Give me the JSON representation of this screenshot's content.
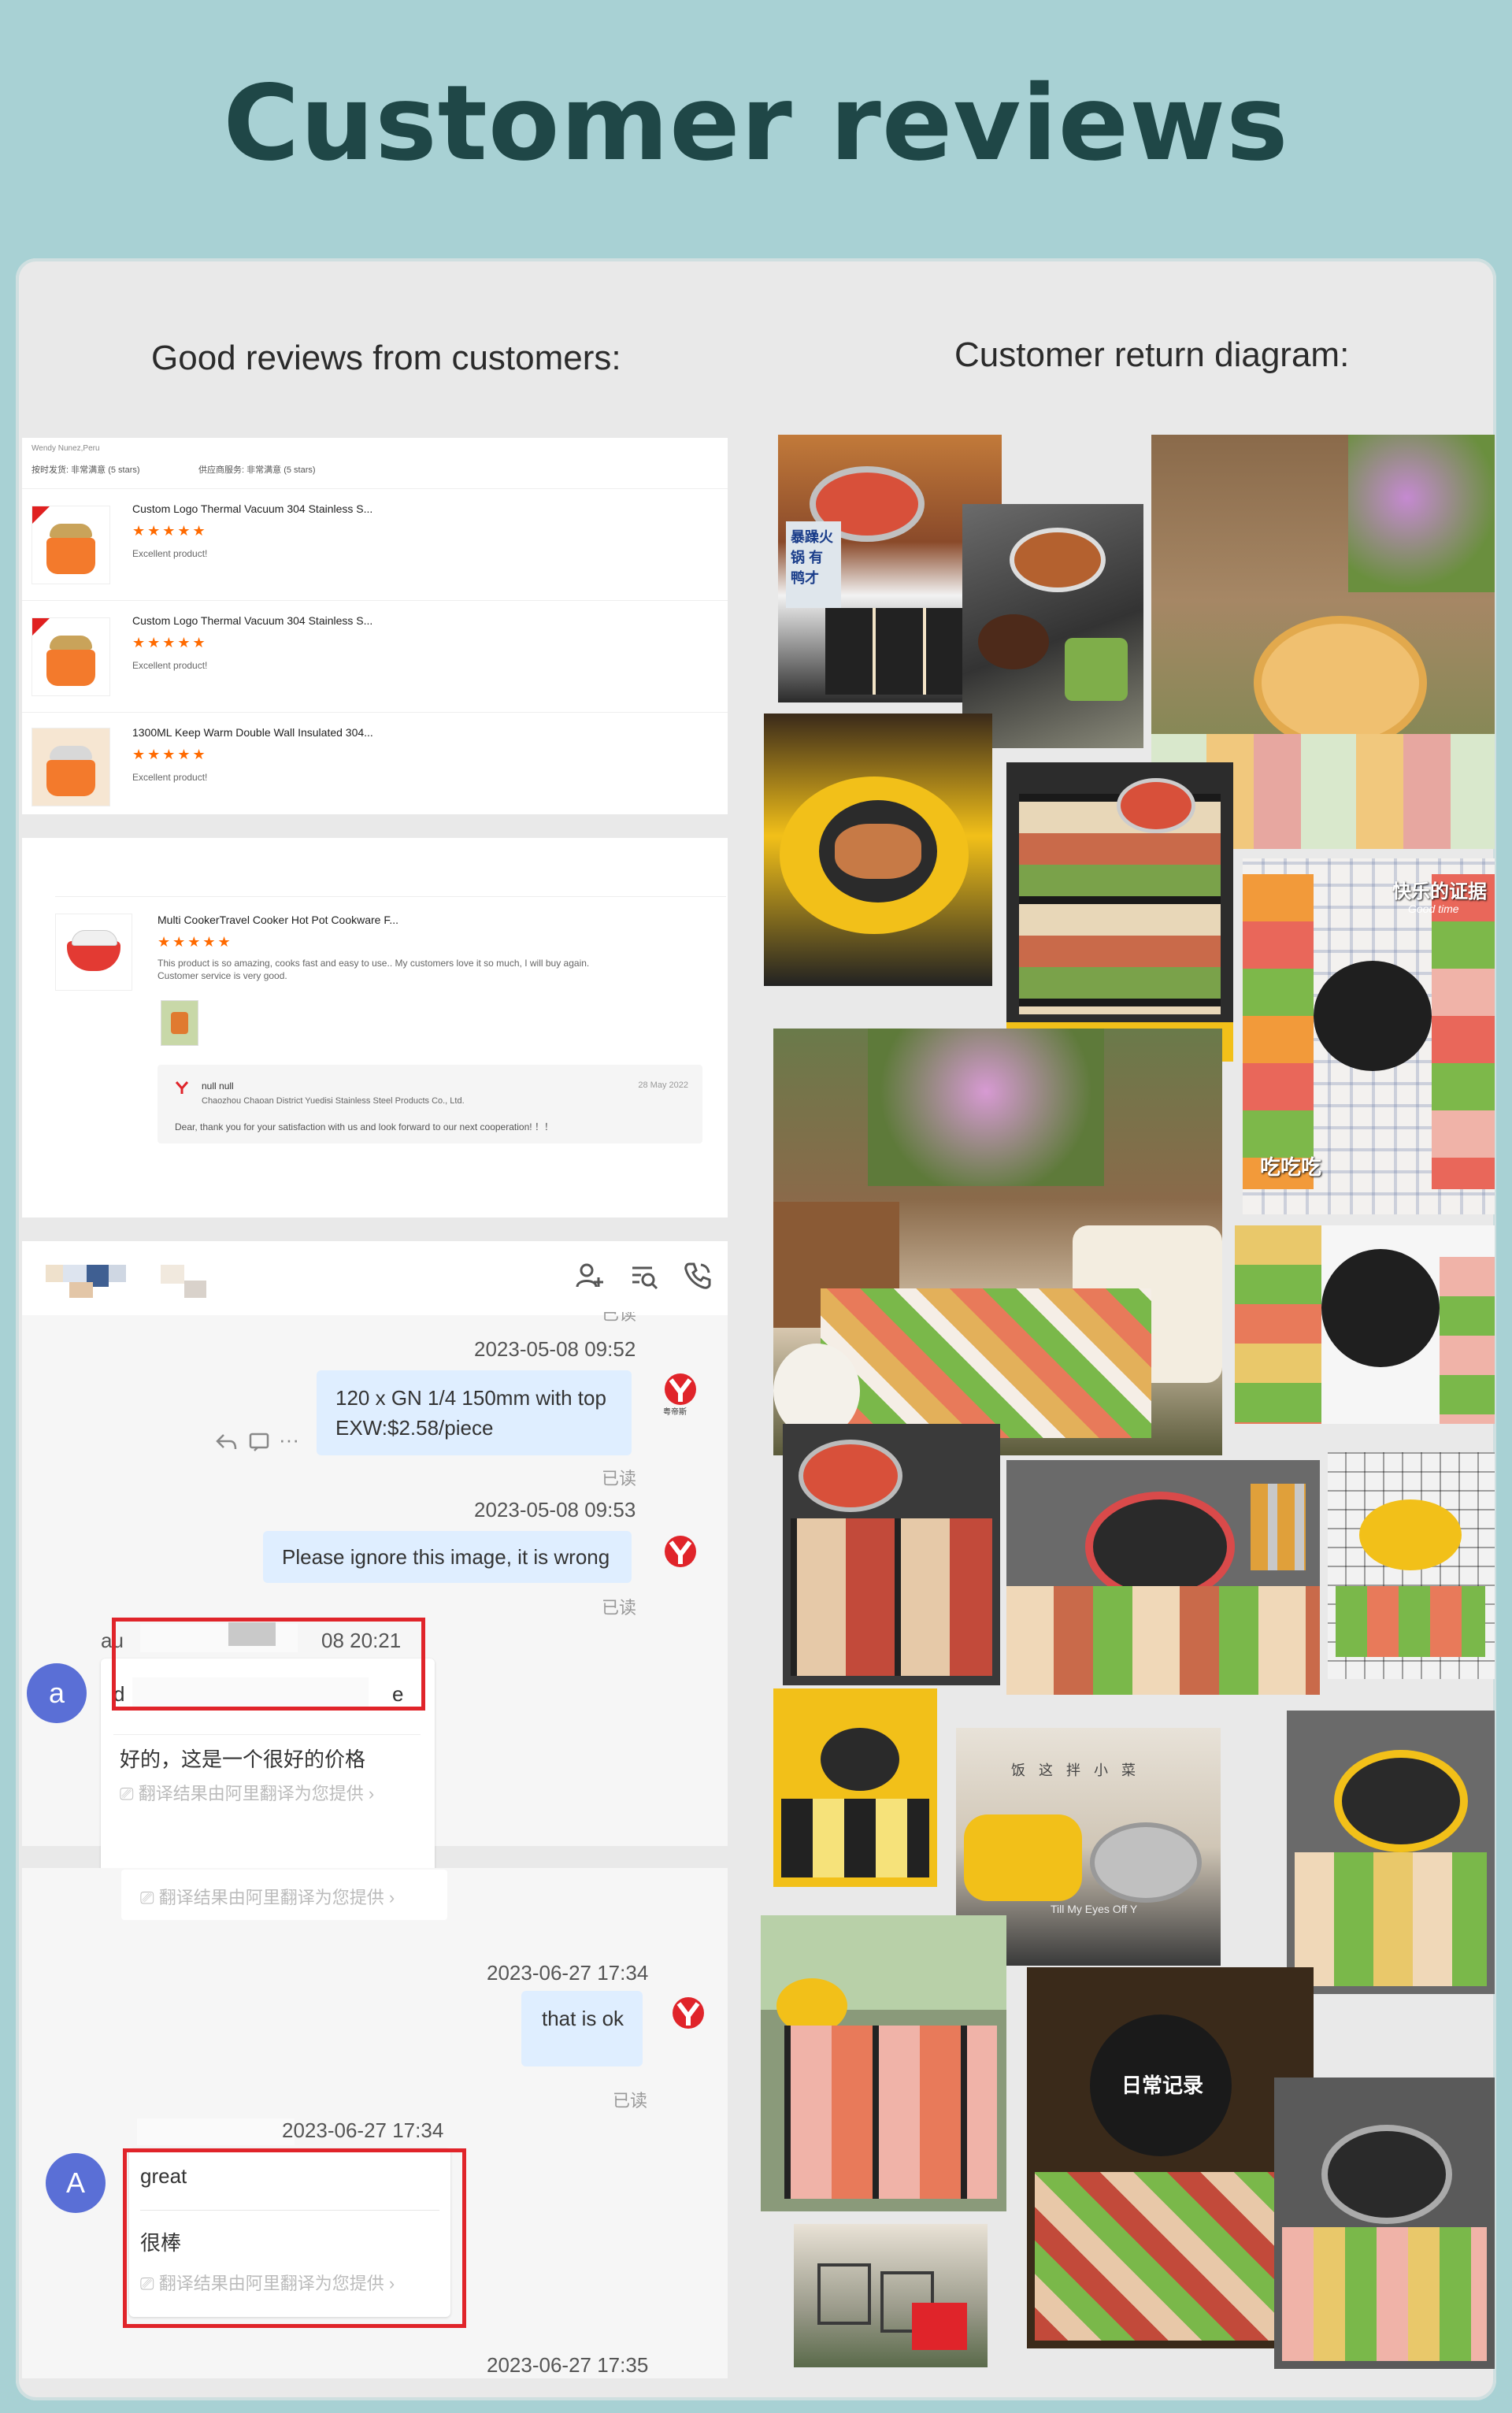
{
  "page_title": "Customer reviews",
  "left_heading": "Good reviews from customers:",
  "right_heading": "Customer return diagram:",
  "reviews_card": {
    "buyer": "Wendy Nunez,Peru",
    "ratings": [
      {
        "label": "按时发货:",
        "value": "非常满意",
        "stars": "(5 stars)"
      },
      {
        "label": "供应商服务:",
        "value": "非常满意",
        "stars": "(5 stars)"
      }
    ],
    "products": [
      {
        "title": "Custom Logo Thermal Vacuum 304 Stainless S...",
        "stars": "★★★★★",
        "note": "Excellent product!"
      },
      {
        "title": "Custom Logo Thermal Vacuum 304 Stainless S...",
        "stars": "★★★★★",
        "note": "Excellent product!"
      },
      {
        "title": "1300ML Keep Warm Double Wall Insulated 304...",
        "stars": "★★★★★",
        "note": "Excellent product!"
      }
    ]
  },
  "review2": {
    "product_title": "Multi CookerTravel Cooker Hot Pot Cookware F...",
    "stars": "★★★★★",
    "text_line1": "This product is so amazing, cooks fast and easy to use.. My customers love it so much, I will buy again.",
    "text_line2": "Customer service is very good.",
    "reply_name": "null null",
    "reply_date": "28 May 2022",
    "reply_company": "Chaozhou Chaoan District Yuedisi Stainless Steel Products Co., Ltd.",
    "reply_text": "Dear, thank you for your satisfaction with us and look forward to our next cooperation! ！！"
  },
  "chat1": {
    "cut_read_top": "已读",
    "msg1_time": "2023-05-08 09:52",
    "msg1_line1": "120 x GN 1/4 150mm with top",
    "msg1_line2": "EXW:$2.58/piece",
    "read1": "已读",
    "msg2_time": "2023-05-08 09:53",
    "msg2_text": "Please ignore this image, it is wrong",
    "read2": "已读",
    "cust_meta_a": "au",
    "cust_meta_b": "08 20:21",
    "cust_line_a": "d",
    "cust_line_b": "e",
    "cust_avatar": "a",
    "cust_translated": "好的，这是一个很好的价格",
    "translate_note": "翻译结果由阿里翻译为您提供",
    "seller_logo_text": "粤帝斯"
  },
  "chat2": {
    "translate_note_top": "翻译结果由阿里翻译为您提供",
    "msg_time": "2023-06-27 17:34",
    "msg_text": "that is ok",
    "read": "已读",
    "cust_time": "2023-06-27 17:34",
    "cust_avatar": "A",
    "cust_msg": "great",
    "cust_translated": "很棒",
    "translate_note": "翻译结果由阿里翻译为您提供",
    "bottom_time": "2023-06-27 17:35"
  },
  "photo_overlays": {
    "p1_sign": "暴躁火锅 有鸭才",
    "p6_label_a": "快乐的证据",
    "p6_label_b": "Good time",
    "p6_label_c": "吃吃吃",
    "p14_line1": "饭 这 拌 小 菜",
    "p14_line2": "Till My Eyes Off Y",
    "p16_logo": "日常记录"
  },
  "colors": {
    "background": "#a8d1d4",
    "title": "#1f4747",
    "panel": "#e9e9e9",
    "star": "#ff6a00",
    "highlight_box": "#e0242a",
    "bubble_seller": "#dfeeff",
    "avatar": "#5a6fd6",
    "pot_orange": "#f37a2c",
    "grill_yellow": "#f2c019"
  },
  "icons": [
    "add-contact-icon",
    "search-chat-icon",
    "phone-icon",
    "reply-icon",
    "translate-icon",
    "more-icon",
    "chevron-right-icon",
    "brand-logo-icon"
  ]
}
